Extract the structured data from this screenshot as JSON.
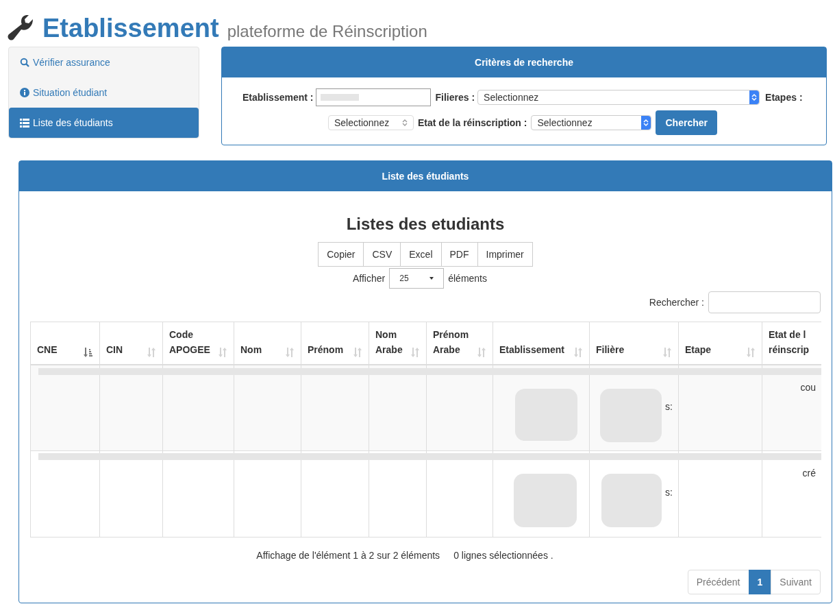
{
  "header": {
    "title": "Etablissement",
    "subtitle": "plateforme de Réinscription"
  },
  "sidebar": {
    "items": [
      {
        "label": "Vérifier assurance",
        "selected": false
      },
      {
        "label": "Situation étudiant",
        "selected": false
      },
      {
        "label": "Liste des étudiants",
        "selected": true
      }
    ]
  },
  "search_panel": {
    "title": "Critères de recherche",
    "etablissement_label": "Etablissement :",
    "filieres_label": "Filieres :",
    "filieres_value": "Selectionnez",
    "etapes_label": "Etapes :",
    "etapes_value": "Selectionnez",
    "etat_label": "Etat de la réinscription :",
    "etat_value": "Selectionnez",
    "button": "Chercher"
  },
  "list_panel": {
    "title": "Liste des étudiants",
    "heading": "Listes des etudiants",
    "export_buttons": [
      "Copier",
      "CSV",
      "Excel",
      "PDF",
      "Imprimer"
    ],
    "length": {
      "before": "Afficher",
      "value": "25",
      "after": "éléments"
    },
    "search_label": "Rechercher :",
    "table": {
      "columns": [
        {
          "lines": [
            "CNE"
          ],
          "sorted": true
        },
        {
          "lines": [
            "CIN"
          ],
          "sorted": false
        },
        {
          "lines": [
            "Code",
            "APOGEE"
          ],
          "sorted": false
        },
        {
          "lines": [
            "Nom"
          ],
          "sorted": false
        },
        {
          "lines": [
            "Prénom"
          ],
          "sorted": false
        },
        {
          "lines": [
            "Nom",
            "Arabe"
          ],
          "sorted": false
        },
        {
          "lines": [
            "Prénom",
            "Arabe"
          ],
          "sorted": false
        },
        {
          "lines": [
            "Etablissement"
          ],
          "sorted": false
        },
        {
          "lines": [
            "Filière"
          ],
          "sorted": false
        },
        {
          "lines": [
            "Etape"
          ],
          "sorted": false
        },
        {
          "lines": [
            "Etat de l",
            "réinscrip"
          ]
        }
      ],
      "rows": [
        {
          "filiere": "s:",
          "etat": "cou"
        },
        {
          "filiere": "s:",
          "etat": "cré"
        }
      ]
    },
    "info": "Affichage de l'élément 1 à 2 sur 2 éléments",
    "selection_info": "0 lignes sélectionnées .",
    "pagination": [
      {
        "label": "Précédent",
        "selected": false
      },
      {
        "label": "1",
        "selected": true
      },
      {
        "label": "Suivant",
        "selected": false
      }
    ]
  }
}
